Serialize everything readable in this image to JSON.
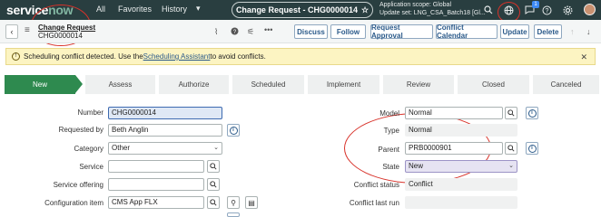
{
  "nav": {
    "logo_prefix": "service",
    "logo_suffix": "now",
    "links": [
      "All",
      "Favorites",
      "History"
    ],
    "record_tab": "Change Request - CHG0000014",
    "scope_line1": "Application scope: Global",
    "scope_line2": "Update set: LNG_CSA_Batch18 [Gl...",
    "notification_count": "1"
  },
  "header": {
    "title": "Change Request",
    "number": "CHG0000014",
    "buttons": [
      "Discuss",
      "Follow",
      "Request Approval",
      "Conflict Calendar",
      "Update",
      "Delete"
    ]
  },
  "warning": {
    "text_before": "Scheduling conflict detected. Use the ",
    "link": "Scheduling Assistant",
    "text_after": " to avoid conflicts."
  },
  "stages": [
    "New",
    "Assess",
    "Authorize",
    "Scheduled",
    "Implement",
    "Review",
    "Closed",
    "Canceled"
  ],
  "form_left": {
    "number_label": "Number",
    "number_value": "CHG0000014",
    "requested_by_label": "Requested by",
    "requested_by_value": "Beth Anglin",
    "category_label": "Category",
    "category_value": "Other",
    "service_label": "Service",
    "service_value": "",
    "service_offering_label": "Service offering",
    "service_offering_value": "",
    "configuration_item_label": "Configuration item",
    "configuration_item_value": "CMS App FLX"
  },
  "form_right": {
    "model_label": "Model",
    "model_value": "Normal",
    "type_label": "Type",
    "type_value": "Normal",
    "parent_label": "Parent",
    "parent_value": "PRB0000901",
    "state_label": "State",
    "state_value": "New",
    "conflict_status_label": "Conflict status",
    "conflict_status_value": "Conflict",
    "conflict_last_run_label": "Conflict last run",
    "conflict_last_run_value": ""
  },
  "colors": {
    "nav_bg": "#293e40",
    "active_stage": "#2e8a4f",
    "warning_bg": "#fcf4c2",
    "annotation": "#d8322a"
  }
}
